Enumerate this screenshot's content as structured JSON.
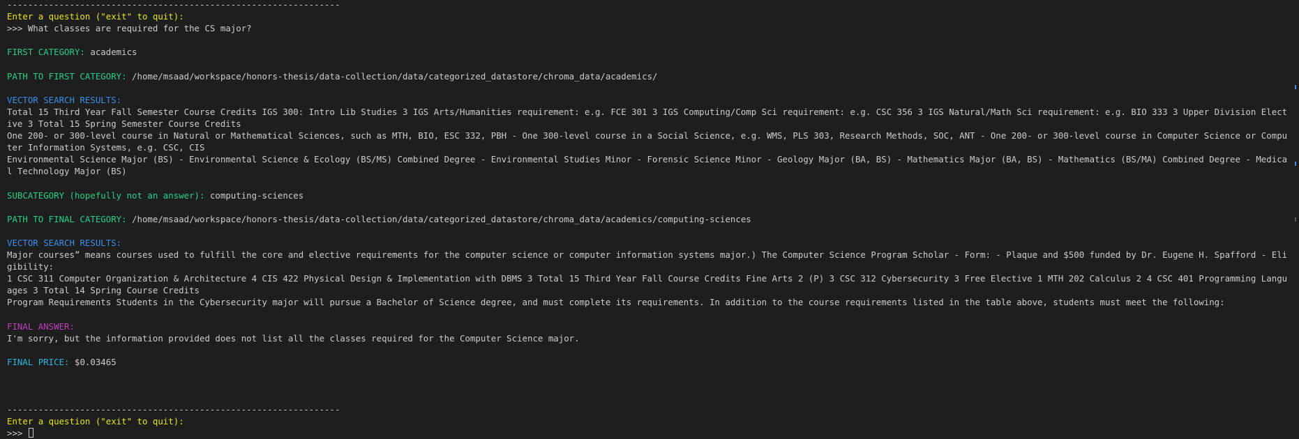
{
  "session": [
    {
      "separator": "----------------------------------------------------------------",
      "prompt": "Enter a question (\"exit\" to quit):",
      "input_prefix": ">>> ",
      "input_value": "What classes are required for the CS major?",
      "first_category_label": "FIRST CATEGORY:",
      "first_category_value": "academics",
      "path_first_label": "PATH TO FIRST CATEGORY:",
      "path_first_value": "/home/msaad/workspace/honors-thesis/data-collection/data/categorized_datastore/chroma_data/academics/",
      "vector_results_label_1": "VECTOR SEARCH RESULTS:",
      "vector_results_1": [
        "Total 15 Third Year Fall Semester Course Credits IGS 300: Intro Lib Studies 3 IGS Arts/Humanities requirement: e.g. FCE 301 3 IGS Computing/Comp Sci requirement: e.g. CSC 356 3 IGS Natural/Math Sci requirement: e.g. BIO 333 3 Upper Division Elective 3 Total 15 Spring Semester Course Credits",
        "One 200- or 300-level course in Natural or Mathematical Sciences, such as MTH, BIO, ESC 332, PBH - One 300-level course in a Social Science, e.g. WMS, PLS 303, Research Methods, SOC, ANT - One 200- or 300-level course in Computer Science or Computer Information Systems, e.g. CSC, CIS",
        "Environmental Science Major (BS) - Environmental Science & Ecology (BS/MS) Combined Degree - Environmental Studies Minor - Forensic Science Minor - Geology Major (BA, BS) - Mathematics Major (BA, BS) - Mathematics (BS/MA) Combined Degree - Medical Technology Major (BS)"
      ],
      "subcategory_label": "SUBCATEGORY (hopefully not an answer):",
      "subcategory_value": "computing-sciences",
      "path_final_label": "PATH TO FINAL CATEGORY:",
      "path_final_value": "/home/msaad/workspace/honors-thesis/data-collection/data/categorized_datastore/chroma_data/academics/computing-sciences",
      "vector_results_label_2": "VECTOR SEARCH RESULTS:",
      "vector_results_2": [
        "Major courses” means courses used to fulfill the core and elective requirements for the computer science or computer information systems major.) The Computer Science Program Scholar - Form: - Plaque and $500 funded by Dr. Eugene H. Spafford - Eligibility:",
        "1 CSC 311 Computer Organization & Architecture 4 CIS 422 Physical Design & Implementation with DBMS 3 Total 15 Third Year Fall Course Credits Fine Arts 2 (P) 3 CSC 312 Cybersecurity 3 Free Elective 1 MTH 202 Calculus 2 4 CSC 401 Programming Languages 3 Total 14 Spring Course Credits",
        "Program Requirements Students in the Cybersecurity major will pursue a Bachelor of Science degree, and must complete its requirements. In addition to the course requirements listed in the table above, students must meet the following:"
      ],
      "final_answer_label": "FINAL ANSWER:",
      "final_answer_value": "I'm sorry, but the information provided does not list all the classes required for the Computer Science major.",
      "final_price_label": "FINAL PRICE:",
      "final_price_value": "$0.03465"
    }
  ],
  "next_prompt": {
    "separator": "----------------------------------------------------------------",
    "prompt": "Enter a question (\"exit\" to quit):",
    "input_prefix": ">>> ",
    "input_value": ""
  },
  "colors": {
    "background": "#1e1e1e",
    "text": "#cccccc",
    "prompt_yellow": "#e5e510",
    "label_green": "#23d18b",
    "label_blue": "#3b8eea",
    "label_magenta": "#bc3fbc",
    "label_cyan": "#29b8db",
    "scroll_marker": "#3b8eea"
  }
}
